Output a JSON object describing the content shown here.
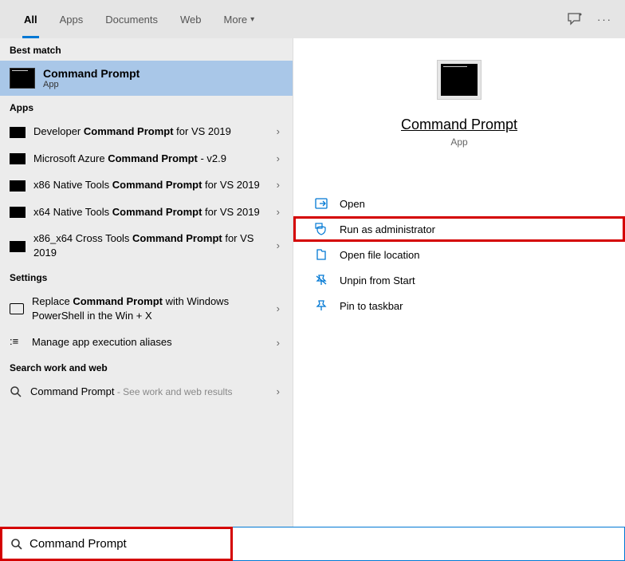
{
  "tabs": {
    "all": "All",
    "apps": "Apps",
    "documents": "Documents",
    "web": "Web",
    "more": "More"
  },
  "sections": {
    "best": "Best match",
    "apps": "Apps",
    "settings": "Settings",
    "web": "Search work and web"
  },
  "best": {
    "title": "Command Prompt",
    "type": "App"
  },
  "apps": [
    {
      "pre": "Developer ",
      "b": "Command Prompt",
      "post": " for VS 2019"
    },
    {
      "pre": "Microsoft Azure ",
      "b": "Command Prompt",
      "post": " - v2.9"
    },
    {
      "pre": "x86 Native Tools ",
      "b": "Command Prompt",
      "post": " for VS 2019"
    },
    {
      "pre": "x64 Native Tools ",
      "b": "Command Prompt",
      "post": " for VS 2019"
    },
    {
      "pre": "x86_x64 Cross Tools ",
      "b": "Command Prompt",
      "post": " for VS 2019"
    }
  ],
  "settings": [
    {
      "pre": "Replace ",
      "b": "Command Prompt",
      "post": " with Windows PowerShell in the Win + X"
    },
    {
      "pre": "Manage app execution aliases",
      "b": "",
      "post": ""
    }
  ],
  "webResult": {
    "text": "Command Prompt",
    "hint": " - See work and web results"
  },
  "preview": {
    "name": "Command Prompt",
    "type": "App"
  },
  "actions": {
    "open": "Open",
    "runAdmin": "Run as administrator",
    "openLoc": "Open file location",
    "unpin": "Unpin from Start",
    "pinTask": "Pin to taskbar"
  },
  "search": {
    "value": "Command Prompt"
  }
}
